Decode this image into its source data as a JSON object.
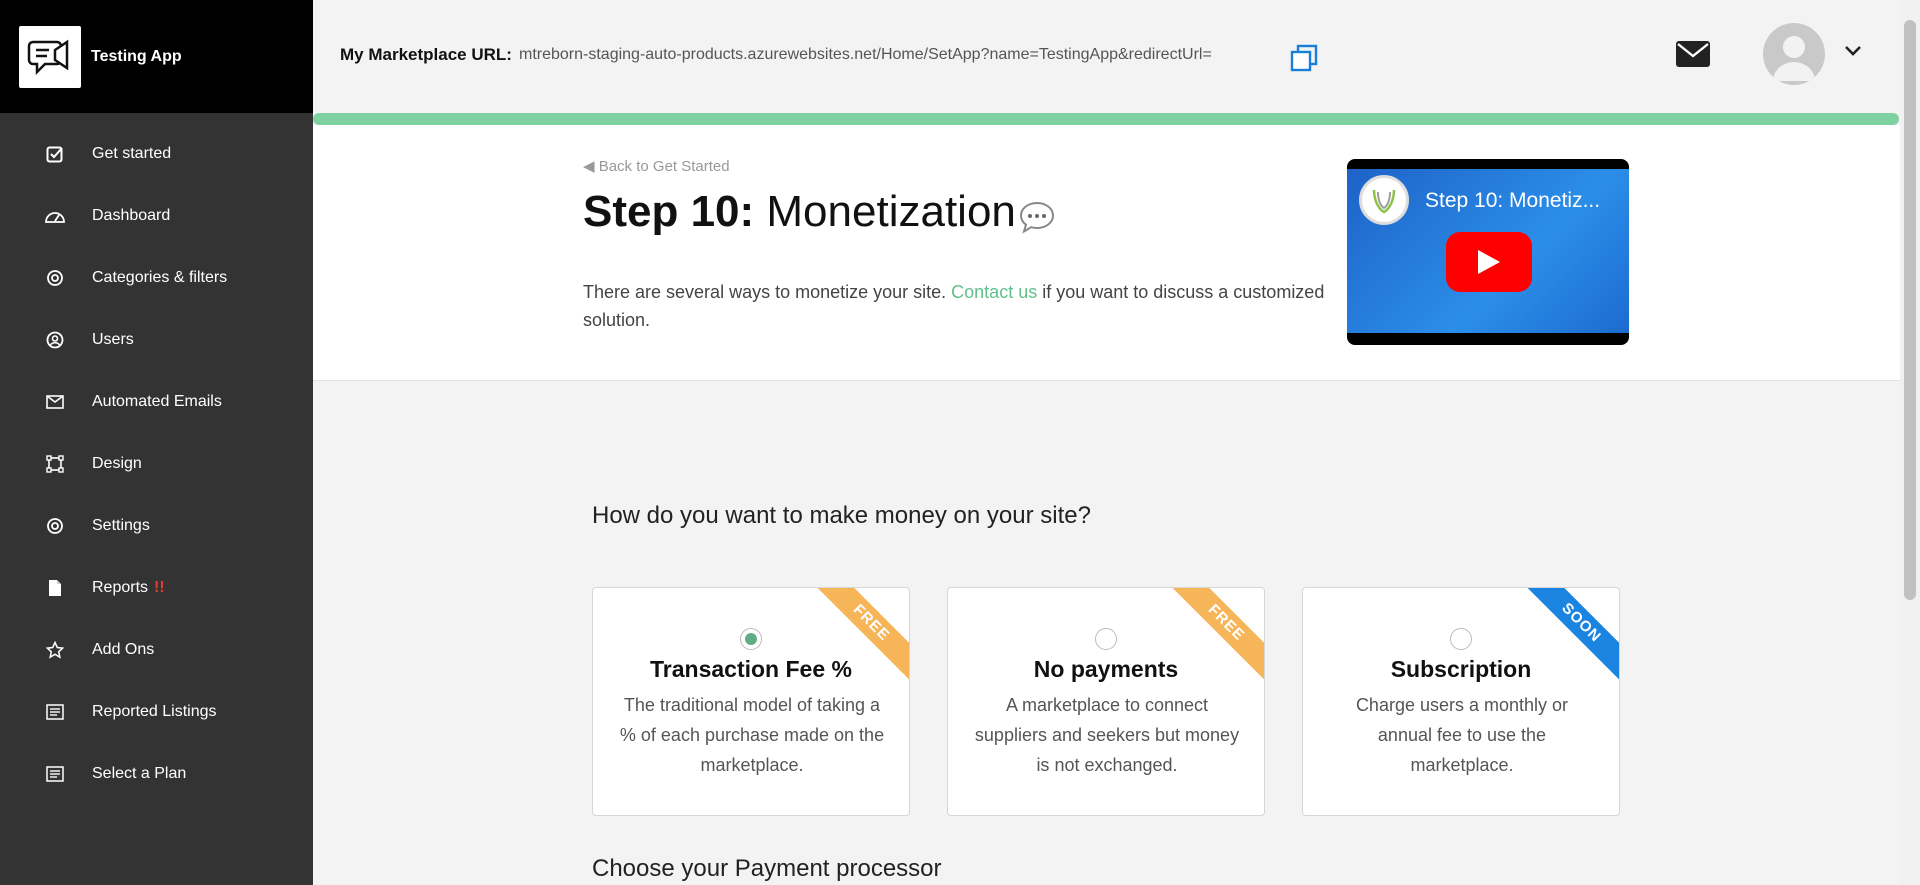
{
  "app": {
    "name": "Testing App"
  },
  "sidebar": {
    "items": [
      {
        "label": "Get started",
        "icon": "checkbox-icon"
      },
      {
        "label": "Dashboard",
        "icon": "gauge-icon"
      },
      {
        "label": "Categories & filters",
        "icon": "gear-icon"
      },
      {
        "label": "Users",
        "icon": "user-circle-icon"
      },
      {
        "label": "Automated Emails",
        "icon": "envelope-icon"
      },
      {
        "label": "Design",
        "icon": "design-frame-icon"
      },
      {
        "label": "Settings",
        "icon": "gear-icon"
      },
      {
        "label": "Reports",
        "icon": "document-icon",
        "alert": "!!"
      },
      {
        "label": "Add Ons",
        "icon": "star-icon"
      },
      {
        "label": "Reported Listings",
        "icon": "list-icon"
      },
      {
        "label": "Select a Plan",
        "icon": "list-icon"
      }
    ]
  },
  "topbar": {
    "marketplace_label": "My Marketplace URL:",
    "marketplace_url": "mtreborn-staging-auto-products.azurewebsites.net/Home/SetApp?name=TestingApp&redirectUrl="
  },
  "header": {
    "back_link": "◀ Back to Get Started",
    "title_step": "Step 10:",
    "title_rest": "Monetization",
    "intro_before": "There are several ways to monetize your site. ",
    "intro_link": "Contact us",
    "intro_after": " if you want to discuss a customized solution.",
    "video_title": "Step 10: Monetiz..."
  },
  "main": {
    "question": "How do you want to make money on your site?",
    "options": [
      {
        "title": "Transaction Fee %",
        "desc": "The traditional model of taking a % of each purchase made on the marketplace.",
        "badge": "FREE",
        "selected": true
      },
      {
        "title": "No payments",
        "desc": "A marketplace to connect suppliers and seekers but money is not exchanged.",
        "badge": "FREE",
        "selected": false
      },
      {
        "title": "Subscription",
        "desc": "Charge users a monthly or annual fee to use the marketplace.",
        "badge": "SOON",
        "selected": false
      }
    ],
    "subheading": "Choose your Payment processor"
  },
  "colors": {
    "sidebar_bg": "#333333",
    "brand_bg": "#000000",
    "accent_green": "#5fc08a",
    "progress_green": "#7fd1a2",
    "badge_free": "#f6b559",
    "badge_soon": "#1a84e0",
    "copy_icon_blue": "#1a7fd8"
  }
}
